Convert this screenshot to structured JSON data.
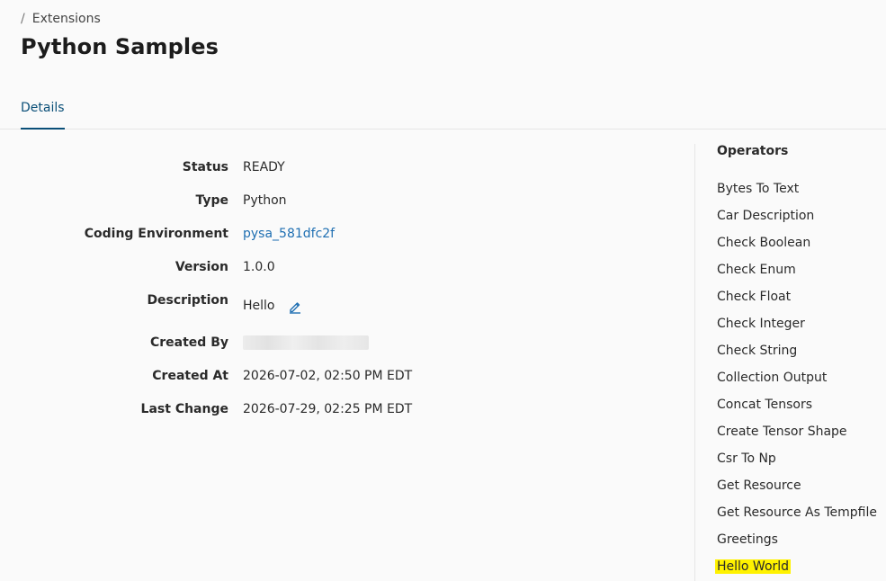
{
  "breadcrumb": {
    "separator": "/",
    "item": "Extensions"
  },
  "page": {
    "title": "Python Samples"
  },
  "tabs": [
    {
      "label": "Details"
    }
  ],
  "details": {
    "status": {
      "label": "Status",
      "value": "READY"
    },
    "type": {
      "label": "Type",
      "value": "Python"
    },
    "coding_environment": {
      "label": "Coding Environment",
      "value": "pysa_581dfc2f"
    },
    "version": {
      "label": "Version",
      "value": "1.0.0"
    },
    "description": {
      "label": "Description",
      "value": "Hello"
    },
    "created_by": {
      "label": "Created By",
      "value": ""
    },
    "created_at": {
      "label": "Created At",
      "value": "2026-07-02, 02:50 PM EDT"
    },
    "last_change": {
      "label": "Last Change",
      "value": "2026-07-29, 02:25 PM EDT"
    }
  },
  "operators": {
    "title": "Operators",
    "items": [
      "Bytes To Text",
      "Car Description",
      "Check Boolean",
      "Check Enum",
      "Check Float",
      "Check Integer",
      "Check String",
      "Collection Output",
      "Concat Tensors",
      "Create Tensor Shape",
      "Csr To Np",
      "Get Resource",
      "Get Resource As Tempfile",
      "Greetings",
      "Hello World"
    ],
    "highlighted_index": 14,
    "highlight_color": "#fff200"
  },
  "colors": {
    "accent": "#0a4f78",
    "link": "#1f6fb2"
  }
}
